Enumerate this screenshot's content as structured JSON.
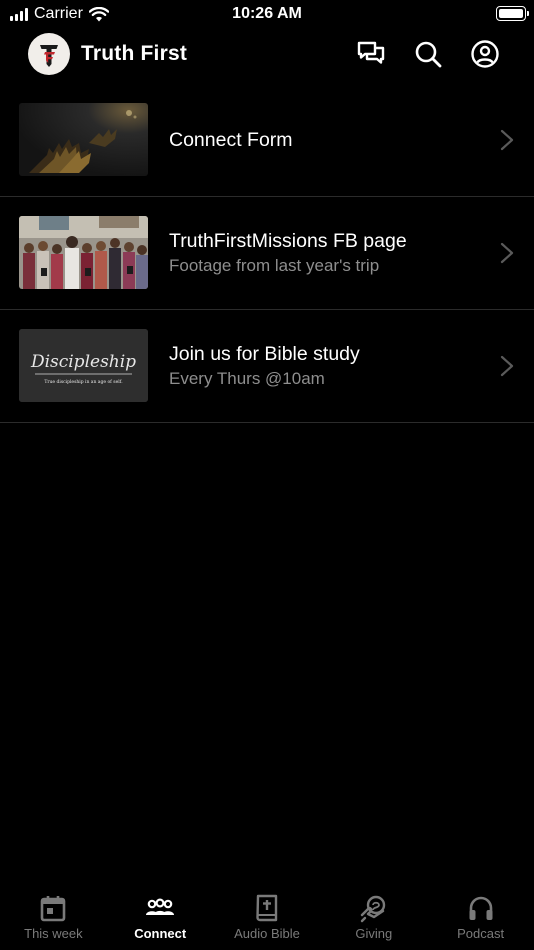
{
  "status_bar": {
    "carrier": "Carrier",
    "time": "10:26 AM"
  },
  "header": {
    "title": "Truth First",
    "logo_text": "TF"
  },
  "items": [
    {
      "title": "Connect Form",
      "subtitle": "",
      "thumb_icon": "hands-raised-worship-image"
    },
    {
      "title": "TruthFirstMissions FB page",
      "subtitle": "Footage from last year's trip",
      "thumb_icon": "mission-group-photo-image"
    },
    {
      "title": "Join us for Bible study",
      "subtitle": "Every Thurs @10am",
      "thumb_icon": "discipleship-chalkboard-image",
      "thumb_text": "Discipleship",
      "thumb_caption": "True discipleship in an age of self."
    }
  ],
  "tabs": [
    {
      "label": "This week",
      "icon": "calendar-icon",
      "active": false
    },
    {
      "label": "Connect",
      "icon": "people-icon",
      "active": true
    },
    {
      "label": "Audio Bible",
      "icon": "bible-icon",
      "active": false
    },
    {
      "label": "Giving",
      "icon": "giving-icon",
      "active": false
    },
    {
      "label": "Podcast",
      "icon": "headphones-icon",
      "active": false
    }
  ],
  "colors": {
    "background": "#000000",
    "text_primary": "#ffffff",
    "text_secondary": "#8e8e8e",
    "tab_inactive": "#7a7a7a",
    "logo_red": "#c0272d"
  }
}
